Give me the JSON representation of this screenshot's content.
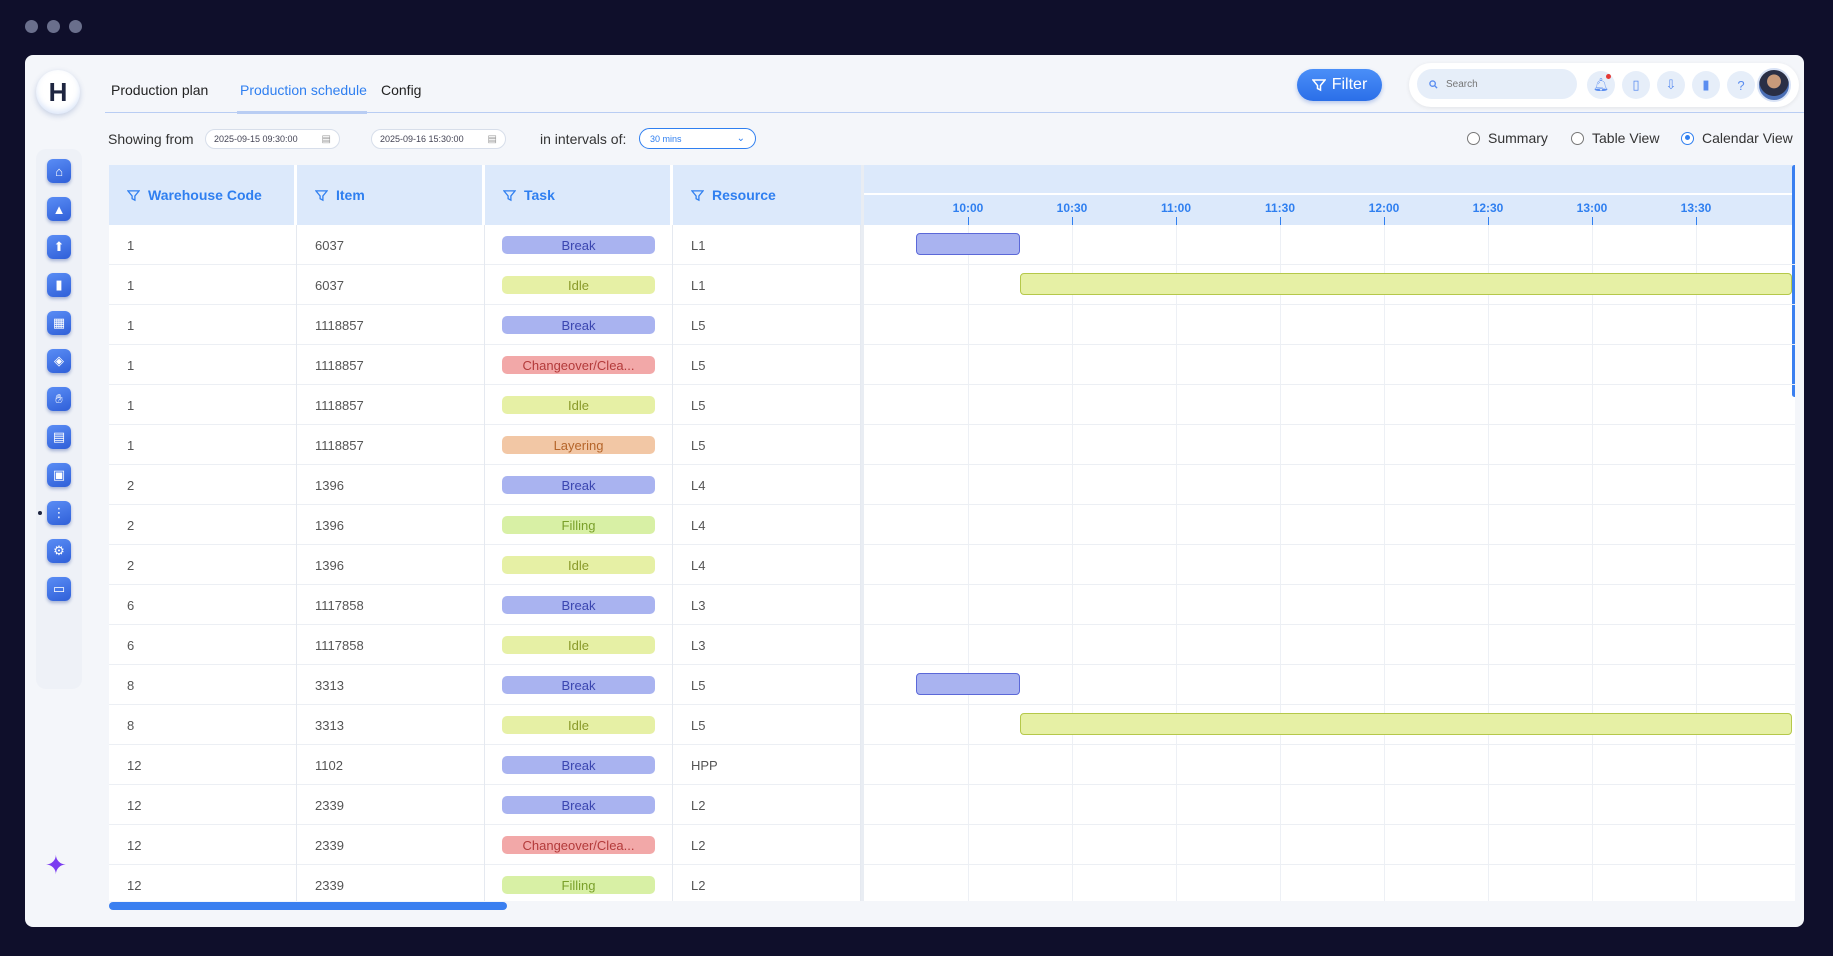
{
  "app": {
    "logo_letter": "H"
  },
  "nav": {
    "tabs": [
      "Production plan",
      "Production schedule",
      "Config"
    ],
    "active": 1
  },
  "toolbar": {
    "filter_label": "Filter",
    "search_placeholder": "Search"
  },
  "filters": {
    "showing_label": "Showing from",
    "from": "2025-09-15 09:30:00",
    "to": "2025-09-16 15:30:00",
    "intervals_label": "in intervals of:",
    "interval": "30 mins"
  },
  "views": {
    "options": [
      "Summary",
      "Table View",
      "Calendar View"
    ],
    "selected": "Calendar View"
  },
  "table": {
    "columns": [
      "Warehouse Code",
      "Item",
      "Task",
      "Resource"
    ],
    "rows": [
      {
        "warehouse": "1",
        "item": "6037",
        "task": "Break",
        "resource": "L1"
      },
      {
        "warehouse": "1",
        "item": "6037",
        "task": "Idle",
        "resource": "L1"
      },
      {
        "warehouse": "1",
        "item": "1118857",
        "task": "Break",
        "resource": "L5"
      },
      {
        "warehouse": "1",
        "item": "1118857",
        "task": "Changeover/Clea...",
        "resource": "L5"
      },
      {
        "warehouse": "1",
        "item": "1118857",
        "task": "Idle",
        "resource": "L5"
      },
      {
        "warehouse": "1",
        "item": "1118857",
        "task": "Layering",
        "resource": "L5"
      },
      {
        "warehouse": "2",
        "item": "1396",
        "task": "Break",
        "resource": "L4"
      },
      {
        "warehouse": "2",
        "item": "1396",
        "task": "Filling",
        "resource": "L4"
      },
      {
        "warehouse": "2",
        "item": "1396",
        "task": "Idle",
        "resource": "L4"
      },
      {
        "warehouse": "6",
        "item": "1117858",
        "task": "Break",
        "resource": "L3"
      },
      {
        "warehouse": "6",
        "item": "1117858",
        "task": "Idle",
        "resource": "L3"
      },
      {
        "warehouse": "8",
        "item": "3313",
        "task": "Break",
        "resource": "L5"
      },
      {
        "warehouse": "8",
        "item": "3313",
        "task": "Idle",
        "resource": "L5"
      },
      {
        "warehouse": "12",
        "item": "1102",
        "task": "Break",
        "resource": "HPP"
      },
      {
        "warehouse": "12",
        "item": "2339",
        "task": "Break",
        "resource": "L2"
      },
      {
        "warehouse": "12",
        "item": "2339",
        "task": "Changeover/Clea...",
        "resource": "L2"
      },
      {
        "warehouse": "12",
        "item": "2339",
        "task": "Filling",
        "resource": "L2"
      }
    ]
  },
  "task_colors": {
    "Break": {
      "bg": "#a9b3f0",
      "fg": "#3a45b0",
      "border": "#5b68d8"
    },
    "Idle": {
      "bg": "#e6f0a5",
      "fg": "#8a9a2a",
      "border": "#b5c84a"
    },
    "Changeover/Clea...": {
      "bg": "#f2a8a8",
      "fg": "#b33a3a",
      "border": "#d86a6a"
    },
    "Layering": {
      "bg": "#f2c7a5",
      "fg": "#b5652a",
      "border": "#d89a6a"
    },
    "Filling": {
      "bg": "#d8f0a5",
      "fg": "#7aa02a",
      "border": "#a8c84a"
    }
  },
  "gantt": {
    "time_labels": [
      "10:00",
      "10:30",
      "11:00",
      "11:30",
      "12:00",
      "12:30",
      "13:00",
      "13:30"
    ],
    "bars": [
      {
        "row": 0,
        "task": "Break",
        "start": "09:45",
        "end": "10:15"
      },
      {
        "row": 1,
        "task": "Idle",
        "start": "10:15",
        "end": "14:00"
      },
      {
        "row": 11,
        "task": "Break",
        "start": "09:45",
        "end": "10:15"
      },
      {
        "row": 12,
        "task": "Idle",
        "start": "10:15",
        "end": "14:00"
      }
    ]
  },
  "sidebar": {
    "icons": [
      "home-icon",
      "pine-icon",
      "box-up-icon",
      "bar-chart-icon",
      "factory-icon",
      "tag-icon",
      "hand-icon",
      "report-icon",
      "message-icon",
      "hierarchy-icon",
      "gear-icon",
      "card-icon"
    ]
  }
}
